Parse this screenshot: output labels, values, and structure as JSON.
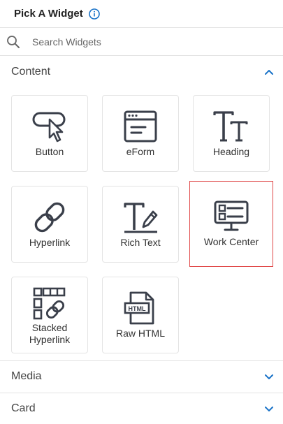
{
  "header": {
    "title": "Pick A Widget",
    "info_icon": "info-icon"
  },
  "search": {
    "placeholder": "Search Widgets",
    "value": ""
  },
  "colors": {
    "accent": "#1a73c8",
    "icon": "#3a3f4a",
    "selected_border": "#e04848"
  },
  "sections": [
    {
      "label": "Content",
      "expanded": true,
      "chevron": "chevron-up-icon"
    },
    {
      "label": "Media",
      "expanded": false,
      "chevron": "chevron-down-icon"
    },
    {
      "label": "Card",
      "expanded": false,
      "chevron": "chevron-down-icon"
    }
  ],
  "widgets": [
    {
      "label": "Button",
      "icon": "button-icon",
      "selected": false
    },
    {
      "label": "eForm",
      "icon": "eform-icon",
      "selected": false
    },
    {
      "label": "Heading",
      "icon": "heading-icon",
      "selected": false
    },
    {
      "label": "Hyperlink",
      "icon": "hyperlink-icon",
      "selected": false
    },
    {
      "label": "Rich Text",
      "icon": "rich-text-icon",
      "selected": false
    },
    {
      "label": "Work Center",
      "icon": "work-center-icon",
      "selected": true
    },
    {
      "label": "Stacked\nHyperlink",
      "icon": "stacked-hyperlink-icon",
      "selected": false
    },
    {
      "label": "Raw HTML",
      "icon": "raw-html-icon",
      "selected": false,
      "icon_text": "HTML"
    }
  ]
}
